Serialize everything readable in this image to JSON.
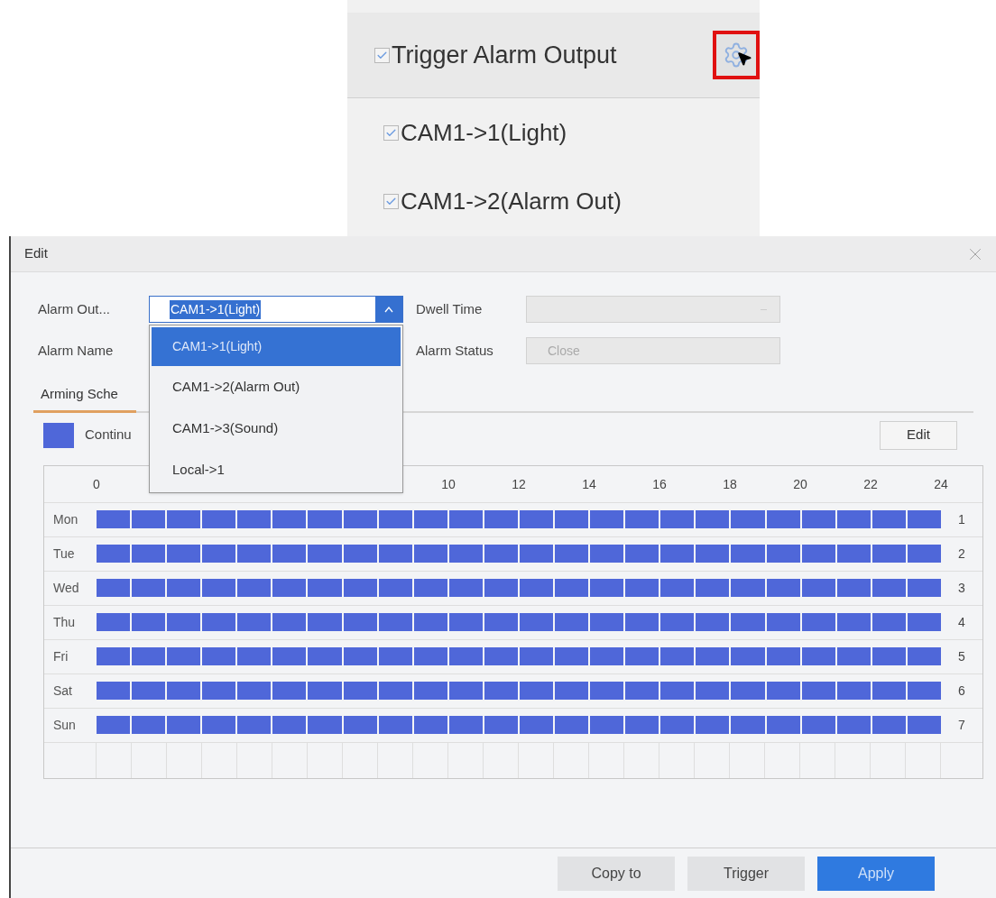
{
  "inset": {
    "header": {
      "label": "Trigger Alarm Output",
      "checked": true
    },
    "items": [
      {
        "label": "CAM1->1(Light)",
        "checked": true
      },
      {
        "label": "CAM1->2(Alarm Out)",
        "checked": true
      }
    ]
  },
  "dialog": {
    "title": "Edit",
    "fields": {
      "alarm_output_label": "Alarm Out...",
      "alarm_output_value": "CAM1->1(Light)",
      "alarm_name_label": "Alarm Name",
      "dwell_time_label": "Dwell Time",
      "alarm_status_label": "Alarm Status",
      "alarm_status_value": "Close"
    },
    "dropdown": {
      "options": [
        {
          "label": "CAM1->1(Light)",
          "selected": true
        },
        {
          "label": "CAM1->2(Alarm Out)",
          "selected": false
        },
        {
          "label": "CAM1->3(Sound)",
          "selected": false
        },
        {
          "label": "Local->1",
          "selected": false
        }
      ]
    },
    "tabs": [
      {
        "label": "Arming Sche",
        "selected": true
      }
    ],
    "legend": {
      "label": "Continu",
      "color": "#4f67d9"
    },
    "edit_button": "Edit",
    "schedule": {
      "ticks_start": [
        "0"
      ],
      "ticks_end": [
        "10",
        "12",
        "14",
        "16",
        "18",
        "20",
        "22",
        "24"
      ],
      "days": [
        {
          "label": "Mon",
          "number": "1",
          "armed": true
        },
        {
          "label": "Tue",
          "number": "2",
          "armed": true
        },
        {
          "label": "Wed",
          "number": "3",
          "armed": true
        },
        {
          "label": "Thu",
          "number": "4",
          "armed": true
        },
        {
          "label": "Fri",
          "number": "5",
          "armed": true
        },
        {
          "label": "Sat",
          "number": "6",
          "armed": true
        },
        {
          "label": "Sun",
          "number": "7",
          "armed": true
        }
      ]
    },
    "buttons": [
      {
        "label": "Copy to",
        "kind": "secondary"
      },
      {
        "label": "Trigger",
        "kind": "secondary"
      },
      {
        "label": "Apply",
        "kind": "primary"
      }
    ]
  }
}
